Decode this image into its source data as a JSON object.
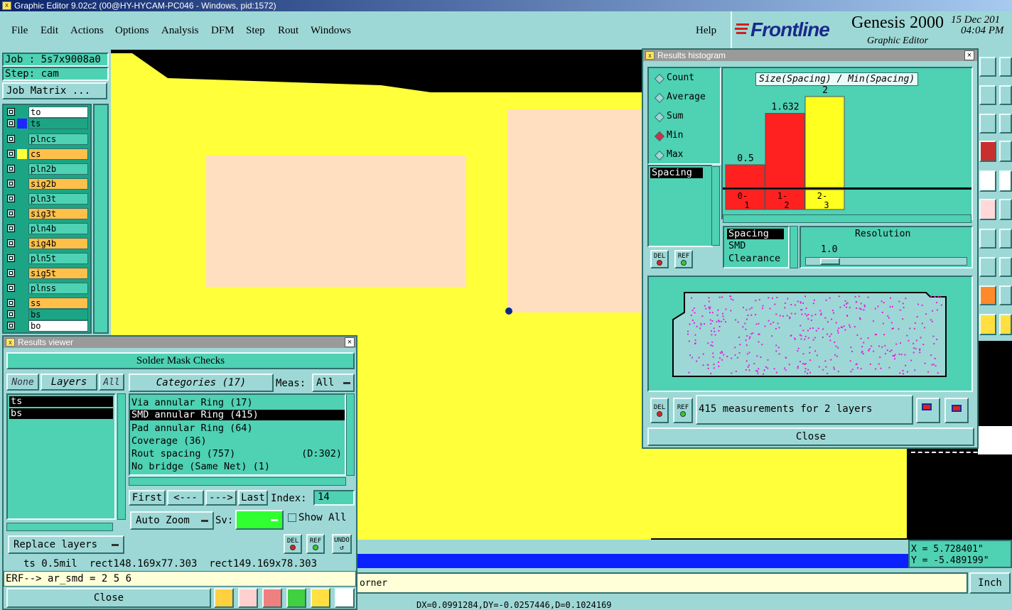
{
  "window": {
    "title": "Graphic Editor 9.02c2 (00@HY-HYCAM-PC046 - Windows, pid:1572)"
  },
  "menu": [
    "File",
    "Edit",
    "Actions",
    "Options",
    "Analysis",
    "DFM",
    "Step",
    "Rout",
    "Windows"
  ],
  "help": "Help",
  "brand": {
    "logo": "Frontline",
    "product": "Genesis 2000",
    "subtitle": "Graphic Editor",
    "date": "15 Dec 201",
    "time": "04:04 PM"
  },
  "job": {
    "job": "Job : 5s7x9008a0",
    "step": "Step: cam",
    "matrix_button": "Job Matrix ..."
  },
  "layers": [
    {
      "name": "to",
      "color": "#ffffff"
    },
    {
      "name": "ts",
      "color": "#1ba584"
    },
    {
      "name": "plncs",
      "color": "#4fd1b3"
    },
    {
      "name": "cs",
      "color": "#ffc04a"
    },
    {
      "name": "pln2b",
      "color": "#4fd1b3"
    },
    {
      "name": "sig2b",
      "color": "#ffc04a"
    },
    {
      "name": "pln3t",
      "color": "#4fd1b3"
    },
    {
      "name": "sig3t",
      "color": "#ffc04a"
    },
    {
      "name": "pln4b",
      "color": "#4fd1b3"
    },
    {
      "name": "sig4b",
      "color": "#ffc04a"
    },
    {
      "name": "pln5t",
      "color": "#4fd1b3"
    },
    {
      "name": "sig5t",
      "color": "#ffc04a"
    },
    {
      "name": "plnss",
      "color": "#4fd1b3"
    },
    {
      "name": "ss",
      "color": "#ffc04a"
    },
    {
      "name": "bs",
      "color": "#1ba584"
    },
    {
      "name": "bo",
      "color": "#ffffff"
    }
  ],
  "results_viewer": {
    "title": "Results viewer",
    "header": "Solder Mask Checks",
    "none": "None",
    "layers": "Layers",
    "all": "All",
    "categories": "Categories (17)",
    "meas_label": "Meas:",
    "meas_value": "All",
    "layer_items": [
      "ts",
      "bs"
    ],
    "items": [
      {
        "label": "Via annular Ring (17)",
        "extra": ""
      },
      {
        "label": "SMD annular Ring (415)",
        "extra": ""
      },
      {
        "label": "Pad annular Ring (64)",
        "extra": ""
      },
      {
        "label": "Coverage (36)",
        "extra": ""
      },
      {
        "label": "Rout spacing (757)",
        "extra": "(D:302)"
      },
      {
        "label": "No bridge (Same Net) (1)",
        "extra": ""
      }
    ],
    "first": "First",
    "prev": "<---",
    "next": "--->",
    "last": "Last",
    "index_label": "Index:",
    "index_value": "14",
    "auto_zoom": "Auto Zoom",
    "sv_label": "Sv:",
    "show_all": "Show All",
    "replace_layers": "Replace layers",
    "del": "DEL",
    "ref": "REF",
    "undo": "UNDO",
    "status": "ts 0.5mil  rect148.169x77.303  rect149.169x78.303",
    "erf": "ERF--> ar_smd = 2 5 6",
    "close": "Close"
  },
  "histogram": {
    "title": "Results histogram",
    "radios": [
      "Count",
      "Average",
      "Sum",
      "Min",
      "Max"
    ],
    "selected": "Min",
    "chart_title": "Size(Spacing) / Min(Spacing)",
    "list_left": [
      "Spacing"
    ],
    "list_right": [
      "Spacing",
      "SMD",
      "Clearance"
    ],
    "resolution_label": "Resolution",
    "resolution_value": "1.0",
    "measurements": "415 measurements for 2 layers",
    "del": "DEL",
    "ref": "REF",
    "close": "Close"
  },
  "chart_data": {
    "type": "bar",
    "title": "Size(Spacing) / Min(Spacing)",
    "categories": [
      "0-1",
      "1-2",
      "2-3"
    ],
    "values": [
      0.5,
      1.632,
      2
    ],
    "value_labels": [
      "0.5",
      "1.632",
      "2"
    ],
    "colors": [
      "#ff2020",
      "#ff2020",
      "#ffff20"
    ]
  },
  "coords": {
    "x": "X = 5.728401\"",
    "y": "Y = -5.489199\""
  },
  "units": "Inch",
  "bottom_text": "orner",
  "bottom_measure": "DX=0.0991284,DY=-0.0257446,D=0.1024169"
}
